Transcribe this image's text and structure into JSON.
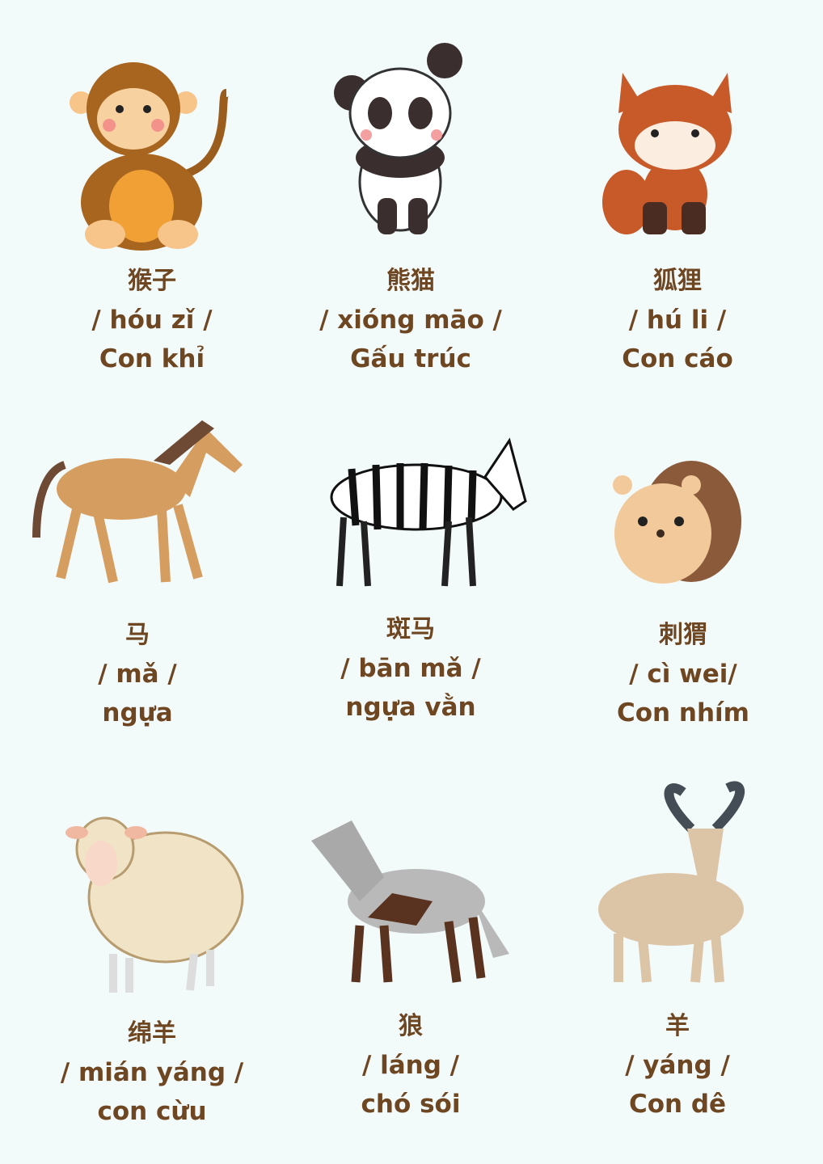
{
  "text_color": "#6e4622",
  "background": "#f2fafa",
  "animals": [
    {
      "icon": "monkey-icon",
      "hanzi": "猴子",
      "pinyin": "/ hóu zǐ /",
      "vietnamese": "Con khỉ"
    },
    {
      "icon": "panda-icon",
      "hanzi": "熊猫",
      "pinyin": "/ xióng māo /",
      "vietnamese": "Gấu trúc"
    },
    {
      "icon": "fox-icon",
      "hanzi": "狐狸",
      "pinyin": "/ hú li /",
      "vietnamese": "Con cáo"
    },
    {
      "icon": "horse-icon",
      "hanzi": "马",
      "pinyin": "/ mǎ /",
      "vietnamese": "ngựa"
    },
    {
      "icon": "zebra-icon",
      "hanzi": "斑马",
      "pinyin": "/ bān mǎ /",
      "vietnamese": "ngựa vằn"
    },
    {
      "icon": "hedgehog-icon",
      "hanzi": "刺猬",
      "pinyin": "/ cì wei/",
      "vietnamese": "Con nhím"
    },
    {
      "icon": "sheep-icon",
      "hanzi": "绵羊",
      "pinyin": "/ mián yáng /",
      "vietnamese": "con cừu"
    },
    {
      "icon": "wolf-icon",
      "hanzi": "狼",
      "pinyin": "/ láng /",
      "vietnamese": "chó sói"
    },
    {
      "icon": "goat-icon",
      "hanzi": "羊",
      "pinyin": "/ yáng /",
      "vietnamese": "Con dê"
    }
  ]
}
